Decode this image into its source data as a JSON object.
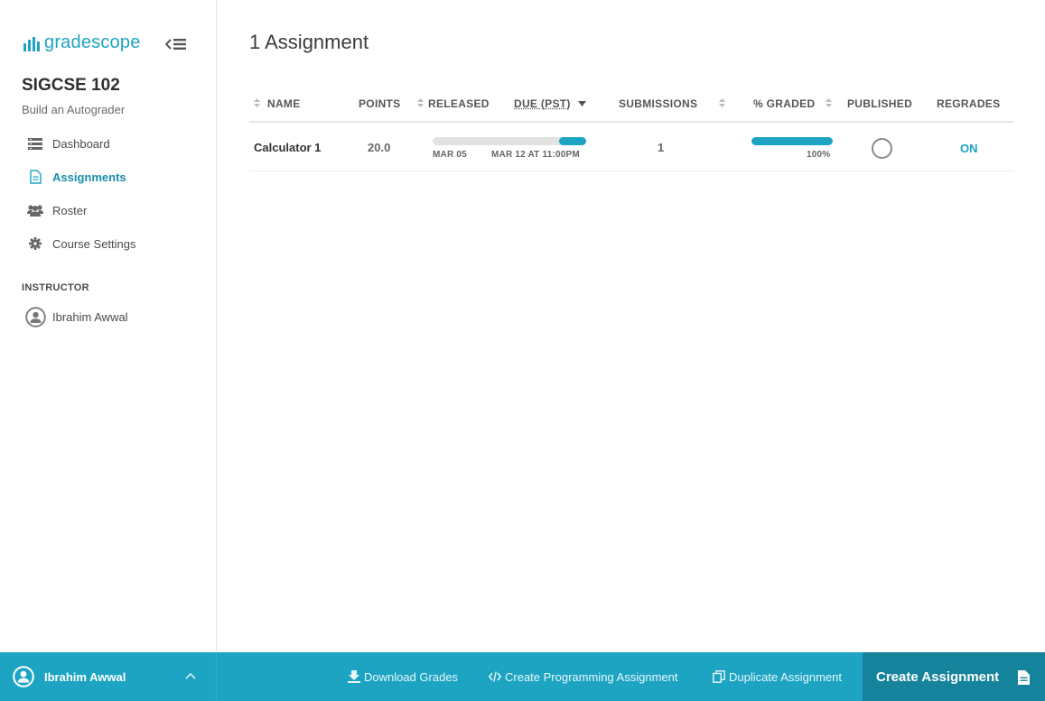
{
  "app": {
    "logo_text": "gradescope"
  },
  "course": {
    "title": "SIGCSE 102",
    "subtitle": "Build an Autograder"
  },
  "sidebar": {
    "items": [
      {
        "label": "Dashboard",
        "icon": "dashboard-icon"
      },
      {
        "label": "Assignments",
        "icon": "document-icon",
        "active": true
      },
      {
        "label": "Roster",
        "icon": "users-icon"
      },
      {
        "label": "Course Settings",
        "icon": "gear-icon"
      }
    ],
    "section_label": "INSTRUCTOR",
    "instructor_name": "Ibrahim Awwal"
  },
  "main": {
    "title": "1 Assignment",
    "columns": {
      "name": "NAME",
      "points": "POINTS",
      "released": "RELEASED",
      "due": "DUE (PST)",
      "submissions": "SUBMISSIONS",
      "graded": "% GRADED",
      "published": "PUBLISHED",
      "regrades": "REGRADES"
    },
    "rows": [
      {
        "name": "Calculator 1",
        "points": "20.0",
        "released": "MAR 05",
        "due": "MAR 12 AT 11:00PM",
        "time_elapsed_fraction": 0.82,
        "submissions": "1",
        "graded_percent": "100%",
        "graded_fraction": 1.0,
        "published": false,
        "regrades": "ON"
      }
    ]
  },
  "footer": {
    "user_name": "Ibrahim Awwal",
    "download_grades": "Download Grades",
    "create_programming": "Create Programming Assignment",
    "duplicate": "Duplicate Assignment",
    "create_assignment": "Create Assignment"
  },
  "colors": {
    "accent": "#1da4c2",
    "accent_dark": "#16839c"
  }
}
